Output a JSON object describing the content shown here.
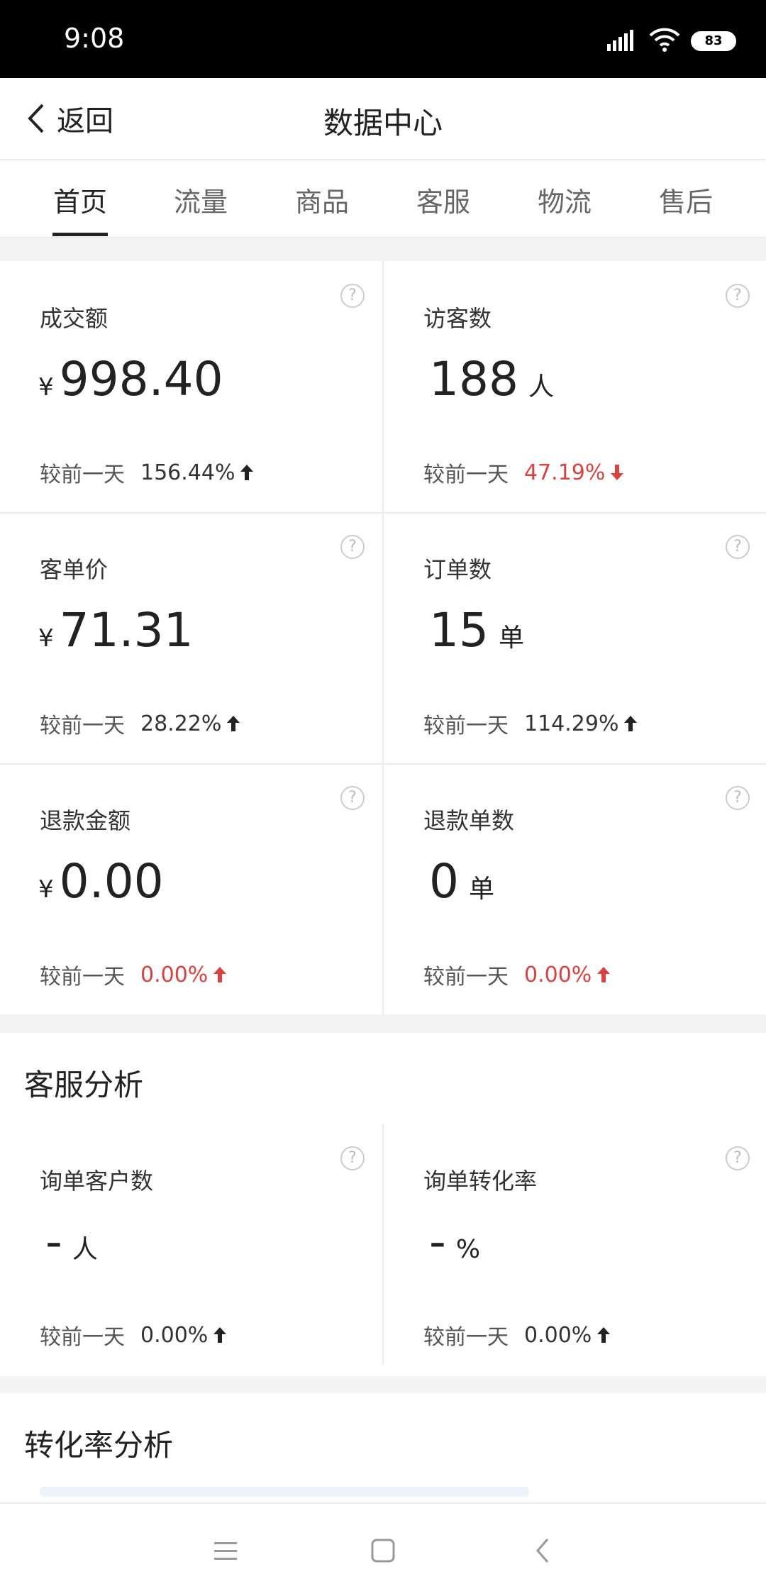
{
  "status_bar": {
    "time": "9:08",
    "battery": "83"
  },
  "header": {
    "back_label": "返回",
    "title": "数据中心"
  },
  "tabs": [
    "首页",
    "流量",
    "商品",
    "客服",
    "物流",
    "售后"
  ],
  "compare_label": "较前一天",
  "metrics": [
    {
      "label": "成交额",
      "currency": "¥",
      "value": "998.40",
      "unit": "",
      "change": "156.44%",
      "direction": "up",
      "color": "#333333"
    },
    {
      "label": "访客数",
      "currency": "",
      "value": "188",
      "unit": "人",
      "change": "47.19%",
      "direction": "down",
      "color": "#d9423f"
    },
    {
      "label": "客单价",
      "currency": "¥",
      "value": "71.31",
      "unit": "",
      "change": "28.22%",
      "direction": "up",
      "color": "#333333"
    },
    {
      "label": "订单数",
      "currency": "",
      "value": "15",
      "unit": "单",
      "change": "114.29%",
      "direction": "up",
      "color": "#333333"
    },
    {
      "label": "退款金额",
      "currency": "¥",
      "value": "0.00",
      "unit": "",
      "change": "0.00%",
      "direction": "up",
      "color": "#d9423f"
    },
    {
      "label": "退款单数",
      "currency": "",
      "value": "0",
      "unit": "单",
      "change": "0.00%",
      "direction": "up",
      "color": "#d9423f"
    }
  ],
  "service_section": {
    "title": "客服分析",
    "metrics": [
      {
        "label": "询单客户数",
        "currency": "",
        "value": "-",
        "unit": "人",
        "change": "0.00%",
        "direction": "up",
        "color": "#333333"
      },
      {
        "label": "询单转化率",
        "currency": "",
        "value": "-",
        "unit": "%",
        "change": "0.00%",
        "direction": "up",
        "color": "#333333"
      }
    ]
  },
  "conversion_section": {
    "title": "转化率分析"
  },
  "help_symbol": "?"
}
